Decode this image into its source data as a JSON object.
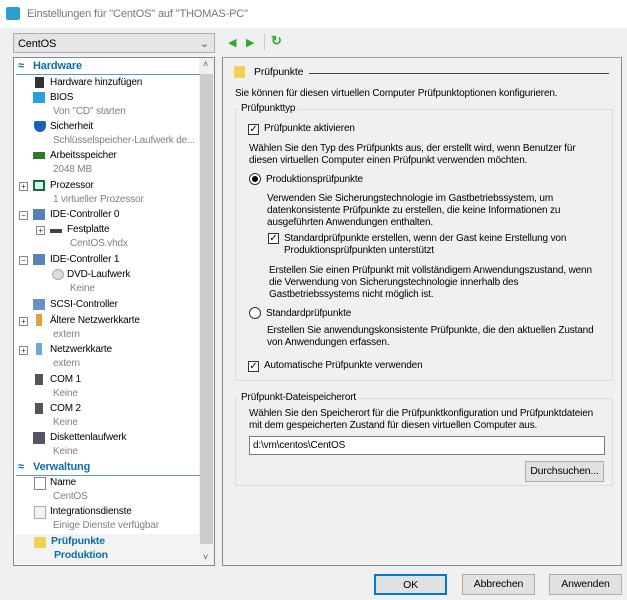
{
  "window": {
    "title": "Einstellungen für \"CentOS\" auf \"THOMAS-PC\""
  },
  "vm_select": {
    "value": "CentOS"
  },
  "tree": {
    "hardware": "Hardware",
    "items": [
      {
        "label": "Hardware hinzufügen"
      },
      {
        "label": "BIOS",
        "sub": "Von \"CD\" starten"
      },
      {
        "label": "Sicherheit",
        "sub": "Schlüsselspeicher-Laufwerk de..."
      },
      {
        "label": "Arbeitsspeicher",
        "sub": "2048 MB"
      },
      {
        "label": "Prozessor",
        "sub": "1 virtueller Prozessor"
      },
      {
        "label": "IDE-Controller 0"
      },
      {
        "label": "Festplatte",
        "sub": "CentOS.vhdx"
      },
      {
        "label": "IDE-Controller 1"
      },
      {
        "label": "DVD-Laufwerk",
        "sub": "Keine"
      },
      {
        "label": "SCSI-Controller"
      },
      {
        "label": "Ältere Netzwerkkarte",
        "sub": "extern"
      },
      {
        "label": "Netzwerkkarte",
        "sub": "extern"
      },
      {
        "label": "COM 1",
        "sub": "Keine"
      },
      {
        "label": "COM 2",
        "sub": "Keine"
      },
      {
        "label": "Diskettenlaufwerk",
        "sub": "Keine"
      }
    ],
    "verwaltung": "Verwaltung",
    "mgmt": [
      {
        "label": "Name",
        "sub": "CentOS"
      },
      {
        "label": "Integrationsdienste",
        "sub": "Einige Dienste verfügbar"
      },
      {
        "label": "Prüfpunkte",
        "sub": "Produktion"
      }
    ]
  },
  "panel": {
    "title": "Prüfpunkte",
    "intro": "Sie können für diesen virtuellen Computer Prüfpunktoptionen konfigurieren.",
    "type_group": "Prüfpunkttyp",
    "enable": "Prüfpunkte aktivieren",
    "enable_desc": [
      "Wählen Sie den Typ des Prüfpunkts aus, der erstellt wird, wenn Benutzer für",
      "diesen virtuellen Computer einen Prüfpunkt verwenden möchten."
    ],
    "prod": "Produktionsprüfpunkte",
    "prod_desc": [
      "Verwenden Sie Sicherungstechnologie im Gastbetriebssystem, um",
      "datenkonsistente Prüfpunkte zu erstellen, die keine Informationen zu",
      "ausgeführten Anwendungen enthalten."
    ],
    "fallback": [
      "Standardprüfpunkte erstellen, wenn der Gast keine Erstellung von",
      "Produktionsprüfpunkten unterstützt"
    ],
    "fallback_desc": [
      "Erstellen Sie einen Prüfpunkt mit vollständigem Anwendungszustand, wenn",
      "die Verwendung von Sicherungstechnologie innerhalb des",
      "Gastbetriebssystems nicht möglich ist."
    ],
    "std": "Standardprüfpunkte",
    "std_desc": [
      "Erstellen Sie anwendungskonsistente Prüfpunkte, die den aktuellen Zustand",
      "von Anwendungen erfassen."
    ],
    "auto": "Automatische Prüfpunkte verwenden",
    "loc_group": "Prüfpunkt-Dateispeicherort",
    "loc_desc": [
      "Wählen Sie den Speicherort für die Prüfpunktkonfiguration und Prüfpunktdateien",
      "mit dem gespeicherten Zustand für diesen virtuellen Computer aus."
    ],
    "path": "d:\\vm\\centos\\CentOS",
    "browse": "Durchsuchen..."
  },
  "buttons": {
    "ok": "OK",
    "cancel": "Abbrechen",
    "apply": "Anwenden"
  },
  "colors": {
    "accent": "#0a6ea8",
    "nav": "#2eaa2e"
  }
}
